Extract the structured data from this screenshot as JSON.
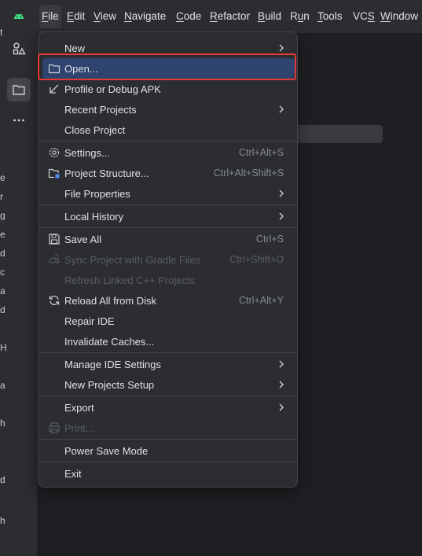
{
  "menubar": {
    "items": [
      {
        "label": "File",
        "mnemonic": "F"
      },
      {
        "label": "Edit",
        "mnemonic": "E"
      },
      {
        "label": "View",
        "mnemonic": "V"
      },
      {
        "label": "Navigate",
        "mnemonic": "N"
      },
      {
        "label": "Code",
        "mnemonic": "C"
      },
      {
        "label": "Refactor",
        "mnemonic": "R"
      },
      {
        "label": "Build",
        "mnemonic": "B"
      },
      {
        "label": "Run",
        "mnemonic": "u"
      },
      {
        "label": "Tools",
        "mnemonic": "T"
      },
      {
        "label": "VCS",
        "mnemonic": "S"
      },
      {
        "label": "Window",
        "mnemonic": "W"
      }
    ]
  },
  "colors": {
    "accent": "#2e436e",
    "annotation": "#e53935",
    "android_green": "#3ddc84"
  },
  "file_menu": {
    "items": [
      {
        "label": "New",
        "submenu": true
      },
      {
        "label": "Open...",
        "icon": "folder-icon",
        "highlighted": true
      },
      {
        "label": "Profile or Debug APK",
        "icon": "arrow-down-left-icon"
      },
      {
        "label": "Recent Projects",
        "submenu": true
      },
      {
        "label": "Close Project"
      },
      {
        "label": "Settings...",
        "icon": "gear-icon",
        "shortcut": "Ctrl+Alt+S"
      },
      {
        "label": "Project Structure...",
        "icon": "project-structure-icon",
        "shortcut": "Ctrl+Alt+Shift+S"
      },
      {
        "label": "File Properties",
        "submenu": true
      },
      {
        "label": "Local History",
        "submenu": true
      },
      {
        "label": "Save All",
        "icon": "save-icon",
        "shortcut": "Ctrl+S"
      },
      {
        "label": "Sync Project with Gradle Files",
        "icon": "gradle-sync-icon",
        "shortcut": "Ctrl+Shift+O",
        "disabled": true
      },
      {
        "label": "Refresh Linked C++ Projects",
        "disabled": true
      },
      {
        "label": "Reload All from Disk",
        "icon": "reload-icon",
        "shortcut": "Ctrl+Alt+Y"
      },
      {
        "label": "Repair IDE"
      },
      {
        "label": "Invalidate Caches..."
      },
      {
        "label": "Manage IDE Settings",
        "submenu": true
      },
      {
        "label": "New Projects Setup",
        "submenu": true
      },
      {
        "label": "Export",
        "submenu": true
      },
      {
        "label": "Print...",
        "icon": "printer-icon",
        "disabled": true
      },
      {
        "label": "Power Save Mode"
      },
      {
        "label": "Exit"
      }
    ]
  },
  "left_strip": {
    "edge_letters": [
      "t",
      "e",
      "r",
      "g",
      "e",
      "d",
      "c",
      "a",
      "d",
      "H",
      "a",
      "h",
      "d",
      "h"
    ]
  }
}
